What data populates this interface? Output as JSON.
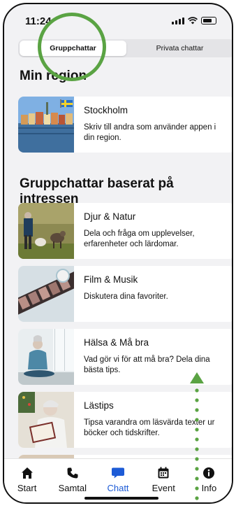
{
  "status_bar": {
    "time": "11:24"
  },
  "segments": [
    {
      "label": "Gruppchattar",
      "active": true
    },
    {
      "label": "Privata chattar",
      "active": false
    }
  ],
  "region_section": {
    "title": "Min region",
    "card": {
      "title": "Stockholm",
      "description": "Skriv till andra som använder appen i din region."
    }
  },
  "interest_section": {
    "title": "Gruppchattar baserat på intressen",
    "cards": [
      {
        "title": "Djur & Natur",
        "description": "Dela och fråga om upplevelser, erfarenheter och lärdomar."
      },
      {
        "title": "Film & Musik",
        "description": "Diskutera dina favoriter."
      },
      {
        "title": "Hälsa & Må bra",
        "description": "Vad gör vi för att må bra? Dela dina bästa tips."
      },
      {
        "title": "Lästips",
        "description": "Tipsa varandra om läsvärda texter ur böcker och tidskrifter."
      }
    ]
  },
  "tab_bar": [
    {
      "label": "Start",
      "icon": "home-icon"
    },
    {
      "label": "Samtal",
      "icon": "phone-icon"
    },
    {
      "label": "Chatt",
      "icon": "chat-icon",
      "active": true
    },
    {
      "label": "Event",
      "icon": "calendar-icon"
    },
    {
      "label": "Info",
      "icon": "info-icon"
    }
  ],
  "colors": {
    "accent": "#1d5bd6",
    "annotation": "#5aa343",
    "background": "#f2f2f4"
  }
}
